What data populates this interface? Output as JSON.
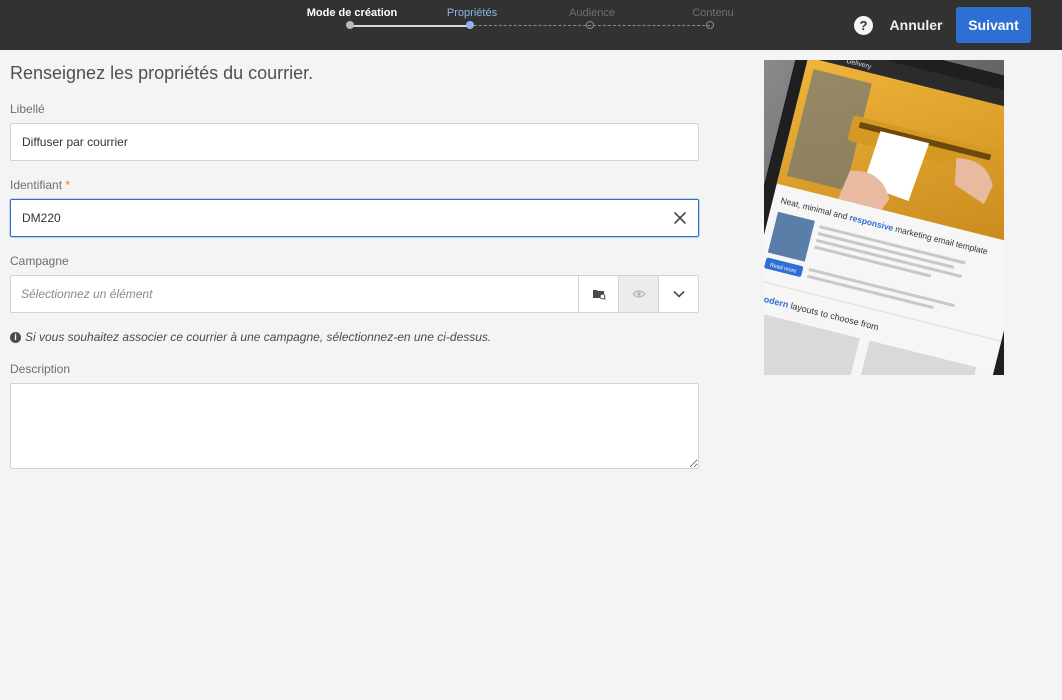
{
  "wizard": {
    "steps": [
      {
        "label": "Mode de création",
        "state": "done"
      },
      {
        "label": "Propriétés",
        "state": "active"
      },
      {
        "label": "Audience",
        "state": "todo"
      },
      {
        "label": "Contenu",
        "state": "todo"
      }
    ]
  },
  "header": {
    "help_icon": "question-circle-icon",
    "help_glyph": "?",
    "cancel_label": "Annuler",
    "next_label": "Suivant"
  },
  "form": {
    "title": "Renseignez les propriétés du courrier.",
    "label_field": {
      "label": "Libellé",
      "value": "Diffuser par courrier"
    },
    "identifier_field": {
      "label": "Identifiant",
      "required_mark": "*",
      "value": "DM220"
    },
    "campaign_field": {
      "label": "Campagne",
      "placeholder": "Sélectionnez un élément",
      "value": "",
      "browse_icon": "folder-browse-icon",
      "preview_icon": "eye-icon",
      "dropdown_icon": "chevron-down-icon"
    },
    "campaign_hint": "Si vous souhaitez associer ce courrier à une campagne, sélectionnez-en une ci-dessus.",
    "hint_icon": "info-circle-icon",
    "hint_glyph": "i",
    "description_field": {
      "label": "Description",
      "value": ""
    }
  },
  "preview": {
    "app_name": "Delivery",
    "headline_parts": [
      "Neat, minimal and ",
      "responsive",
      " marketing email template"
    ],
    "button_label": "Read more",
    "subheadline_parts": [
      "Modern",
      " layouts to choose from"
    ]
  },
  "colors": {
    "topbar": "#323232",
    "accent": "#2d6fd2",
    "active_step": "#8fb4ec",
    "required": "#e68619",
    "background": "#f4f4f4"
  }
}
